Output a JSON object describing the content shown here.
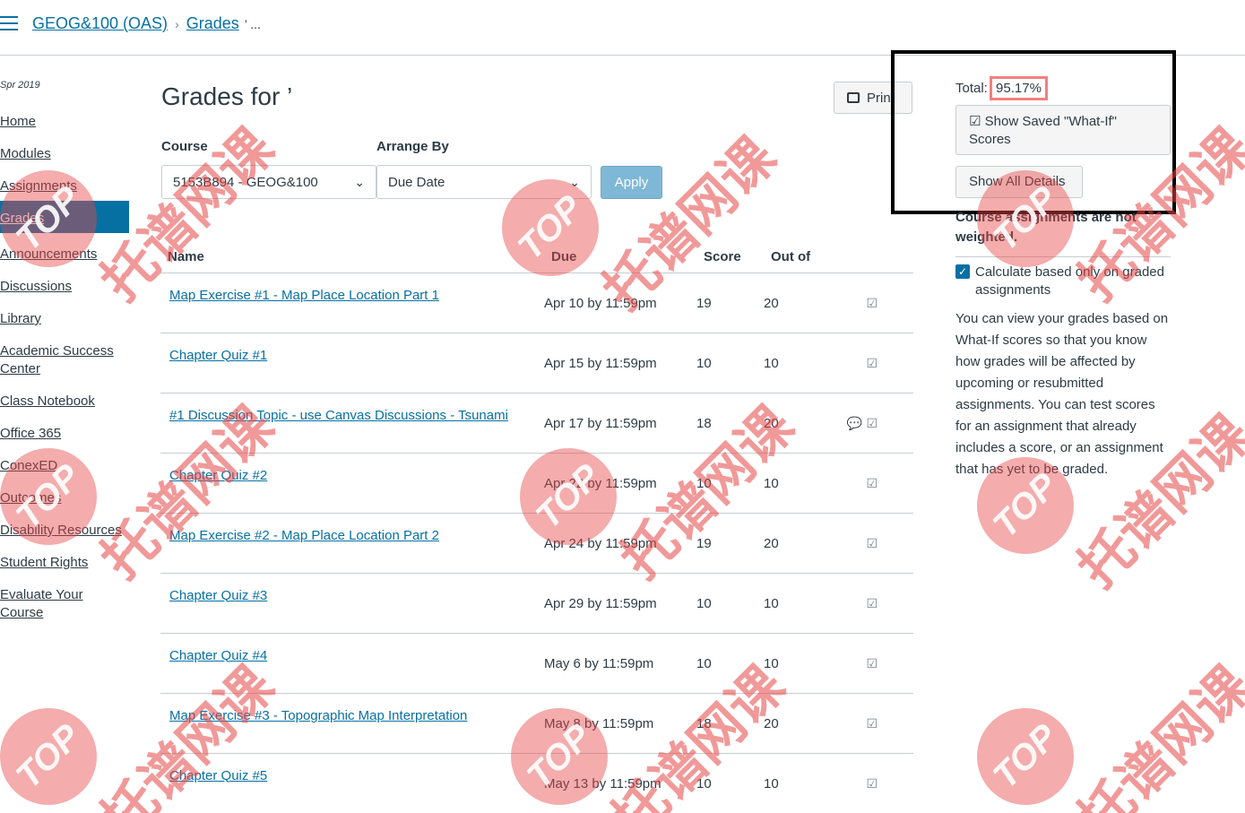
{
  "header": {
    "course_link": "GEOG&100 (OAS)",
    "grades_link": "Grades",
    "separator": "›",
    "current": "’ ..."
  },
  "sidebar": {
    "term": "Spr 2019",
    "items": [
      {
        "label": "Home"
      },
      {
        "label": "Modules"
      },
      {
        "label": "Assignments"
      },
      {
        "label": "Grades"
      },
      {
        "label": "Announcements"
      },
      {
        "label": "Discussions"
      },
      {
        "label": "Library"
      },
      {
        "label": "Academic Success Center"
      },
      {
        "label": "Class Notebook"
      },
      {
        "label": "Office 365"
      },
      {
        "label": "ConexED"
      },
      {
        "label": "Outcomes"
      },
      {
        "label": "Disability Resources"
      },
      {
        "label": "Student Rights"
      },
      {
        "label": "Evaluate Your Course"
      }
    ],
    "active_item": "Grades"
  },
  "main": {
    "title": "Grades for ’",
    "print_label": "Print",
    "course_label": "Course",
    "course_value": "5153B894 - GEOG&100",
    "arrange_label": "Arrange By",
    "arrange_value": "Due Date",
    "apply_label": "Apply",
    "columns": {
      "name": "Name",
      "due": "Due",
      "score": "Score",
      "out_of": "Out of"
    },
    "rows": [
      {
        "name": "Map Exercise #1 - Map Place Location Part 1",
        "due": "Apr 10 by 11:59pm",
        "score": "19",
        "out_of": "20",
        "comment": false
      },
      {
        "name": "Chapter Quiz #1",
        "due": "Apr 15 by 11:59pm",
        "score": "10",
        "out_of": "10",
        "comment": false
      },
      {
        "name": "#1 Discussion Topic - use Canvas Discussions - Tsunami",
        "due": "Apr 17 by 11:59pm",
        "score": "18",
        "out_of": "20",
        "comment": true
      },
      {
        "name": "Chapter Quiz #2",
        "due": "Apr 22 by 11:59pm",
        "score": "10",
        "out_of": "10",
        "comment": false
      },
      {
        "name": "Map Exercise #2 - Map Place Location Part 2",
        "due": "Apr 24 by 11:59pm",
        "score": "19",
        "out_of": "20",
        "comment": false
      },
      {
        "name": "Chapter Quiz #3",
        "due": "Apr 29 by 11:59pm",
        "score": "10",
        "out_of": "10",
        "comment": false
      },
      {
        "name": "Chapter Quiz #4",
        "due": "May 6 by 11:59pm",
        "score": "10",
        "out_of": "10",
        "comment": false
      },
      {
        "name": "Map Exercise #3 - Topographic Map Interpretation",
        "due": "May 8 by 11:59pm",
        "score": "18",
        "out_of": "20",
        "comment": false
      },
      {
        "name": "Chapter Quiz #5",
        "due": "May 13 by 11:59pm",
        "score": "10",
        "out_of": "10",
        "comment": false
      }
    ]
  },
  "right_panel": {
    "total_label": "Total:",
    "total_value": "95.17%",
    "show_whatif_label": "Show Saved \"What-If\" Scores",
    "show_details_label": "Show All Details",
    "weight_note": "Course assignments are not weighted.",
    "checkbox_label": "Calculate based only on graded assignments",
    "checkbox_checked": true,
    "help_text": "You can view your grades based on What-If scores so that you know how grades will be affected by upcoming or resubmitted assignments. You can test scores for an assignment that already includes a score, or an assignment that has yet to be graded."
  },
  "watermark": {
    "badge": "TOP",
    "text": "托谱网课"
  },
  "colors": {
    "link": "#0770a3",
    "active_nav": "#0770a3",
    "highlight_border": "#f08080",
    "watermark": "#e64646"
  }
}
